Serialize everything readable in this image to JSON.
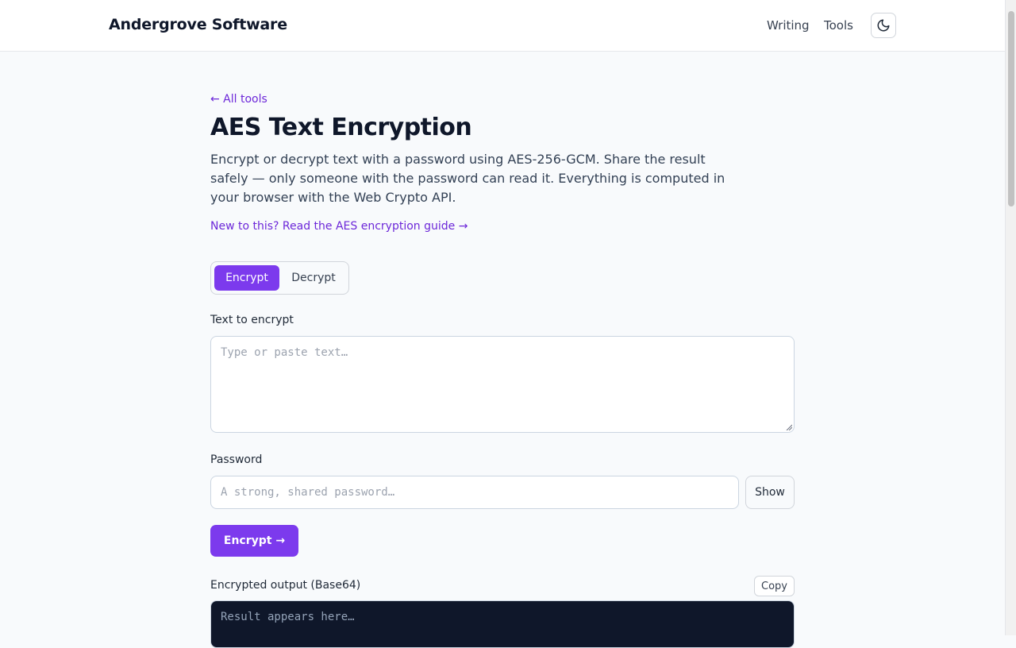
{
  "header": {
    "brand": "Andergrove Software",
    "nav": [
      {
        "label": "Writing"
      },
      {
        "label": "Tools"
      }
    ],
    "theme_icon": "moon-icon"
  },
  "page": {
    "back_link": "← All tools",
    "title": "AES Text Encryption",
    "intro": "Encrypt or decrypt text with a password using AES-256-GCM. Share the result safely — only someone with the password can read it. Everything is computed in your browser with the Web Crypto API.",
    "guide_link": "New to this? Read the AES encryption guide →"
  },
  "mode": {
    "options": [
      {
        "label": "Encrypt",
        "selected": true
      },
      {
        "label": "Decrypt",
        "selected": false
      }
    ]
  },
  "form": {
    "text_label": "Text to encrypt",
    "text_placeholder": "Type or paste text…",
    "text_value": "",
    "password_label": "Password",
    "password_placeholder": "A strong, shared password…",
    "password_value": "",
    "show_button": "Show",
    "submit_button": "Encrypt →"
  },
  "output": {
    "label": "Encrypted output (Base64)",
    "copy_button": "Copy",
    "placeholder": "Result appears here…"
  },
  "colors": {
    "accent": "#7c3aed",
    "link": "#6d28d9",
    "output_bg": "#0f172a"
  }
}
